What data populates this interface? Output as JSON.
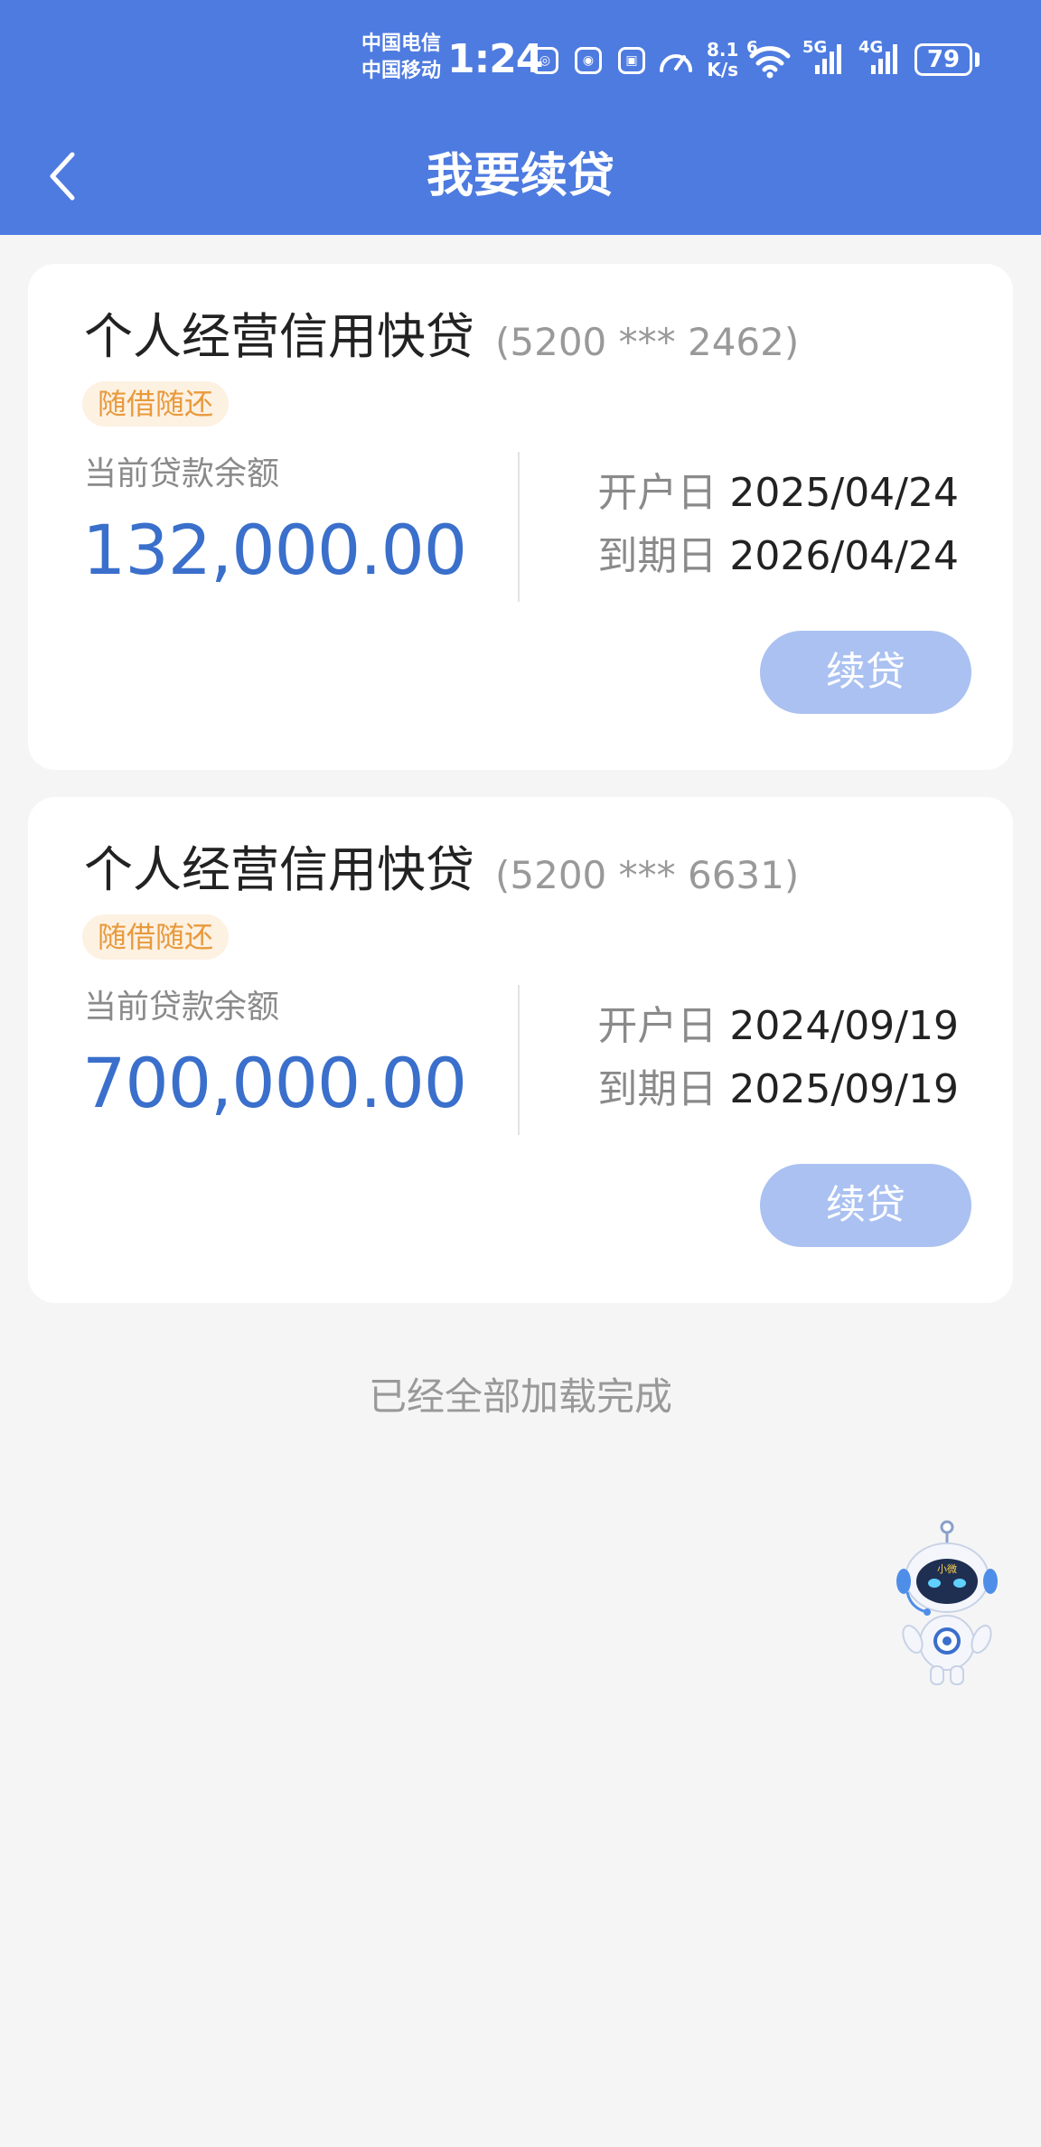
{
  "status_bar": {
    "carrier_1": "中国电信",
    "carrier_2": "中国移动",
    "time": "1:24",
    "net_speed_value": "8.1",
    "net_speed_unit": "K/s",
    "wifi_tag": "6",
    "signal_5g_tag": "5G",
    "signal_4g_tag": "4G",
    "battery": "79"
  },
  "header": {
    "title": "我要续贷"
  },
  "loans": [
    {
      "product_name": "个人经营信用快贷",
      "account_no": "(5200 *** 2462)",
      "tag": "随借随还",
      "balance_label": "当前贷款余额",
      "balance": "132,000.00",
      "open_label": "开户日",
      "open_date": "2025/04/24",
      "due_label": "到期日",
      "due_date": "2026/04/24",
      "button_label": "续贷"
    },
    {
      "product_name": "个人经营信用快贷",
      "account_no": "(5200 *** 6631)",
      "tag": "随借随还",
      "balance_label": "当前贷款余额",
      "balance": "700,000.00",
      "open_label": "开户日",
      "open_date": "2024/09/19",
      "due_label": "到期日",
      "due_date": "2025/09/19",
      "button_label": "续贷"
    }
  ],
  "footer": {
    "load_complete": "已经全部加载完成"
  },
  "assistant": {
    "badge": "小微"
  },
  "colors": {
    "header_bg": "#4e7be0",
    "amount": "#3a6fcb",
    "tag_text": "#e89a3c",
    "tag_bg": "#fdf1e2",
    "button_bg": "#aac1f1"
  }
}
